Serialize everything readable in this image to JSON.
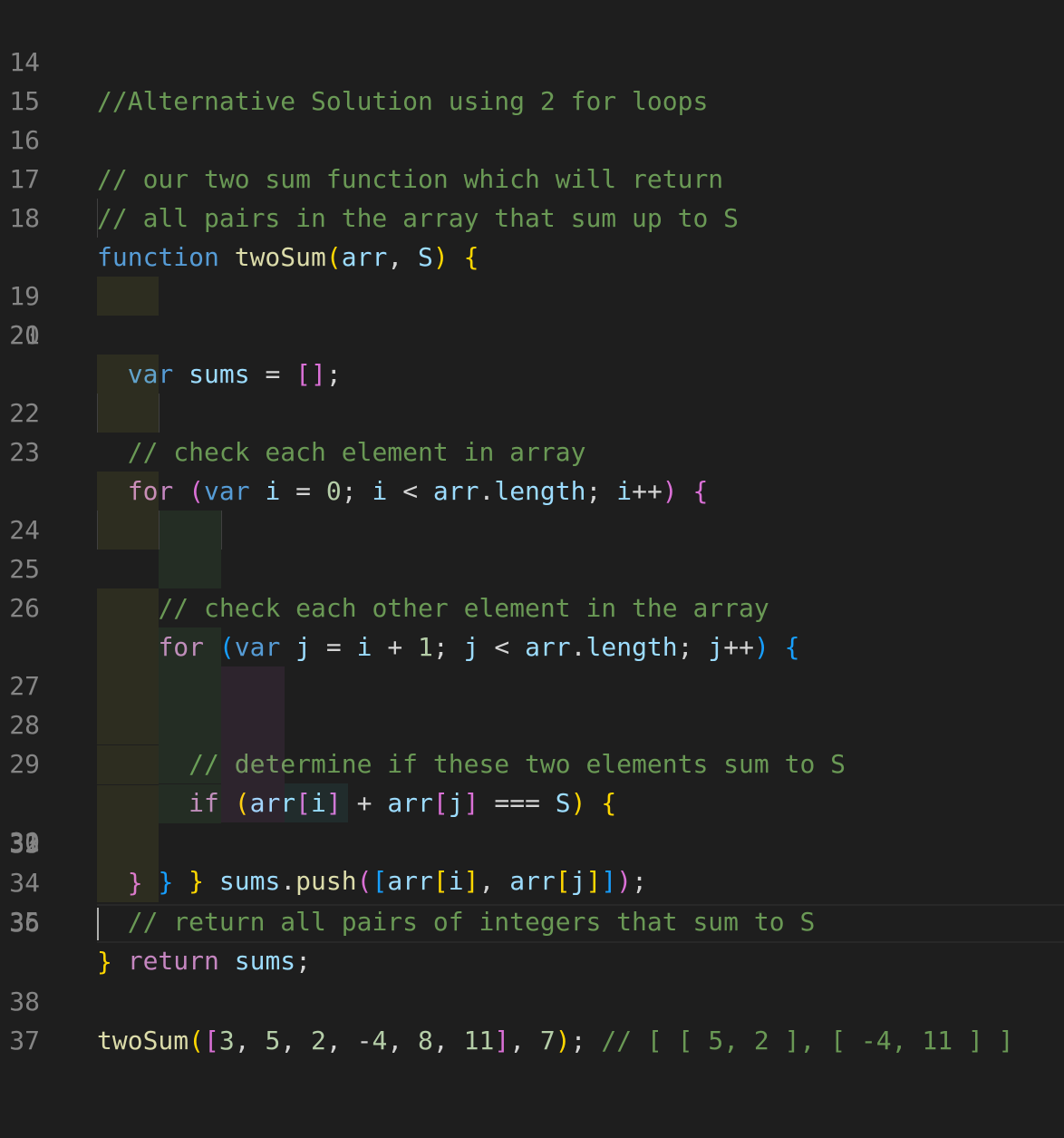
{
  "editor": {
    "lines": [
      {
        "n": "14",
        "text": "//Alternative Solution using 2 for loops"
      },
      {
        "n": "15",
        "text": ""
      },
      {
        "n": "16",
        "text": "// our two sum function which will return"
      },
      {
        "n": "17",
        "text": "// all pairs in the array that sum up to S"
      },
      {
        "n": "18",
        "text": "function twoSum(arr, S) {"
      },
      {
        "n": "19",
        "text": ""
      },
      {
        "n": "20",
        "text": "  var sums = [];"
      },
      {
        "n": "21",
        "text": ""
      },
      {
        "n": "22",
        "text": "  // check each element in array"
      },
      {
        "n": "23",
        "text": "  for (var i = 0; i < arr.length; i++) {"
      },
      {
        "n": "24",
        "text": ""
      },
      {
        "n": "25",
        "text": "    // check each other element in the array"
      },
      {
        "n": "26",
        "text": "    for (var j = i + 1; j < arr.length; j++) {"
      },
      {
        "n": "27",
        "text": ""
      },
      {
        "n": "28",
        "text": "      // determine if these two elements sum to S"
      },
      {
        "n": "29",
        "text": "      if (arr[i] + arr[j] === S) {"
      },
      {
        "n": "30",
        "text": "        sums.push([arr[i], arr[j]]);"
      },
      {
        "n": "31",
        "text": "      }"
      },
      {
        "n": "32",
        "text": "    }"
      },
      {
        "n": "33",
        "text": "  }"
      },
      {
        "n": "34",
        "text": "  // return all pairs of integers that sum to S"
      },
      {
        "n": "35",
        "text": "  return sums;"
      },
      {
        "n": "36",
        "text": "}"
      },
      {
        "n": "37",
        "text": ""
      },
      {
        "n": "38",
        "text": "twoSum([3, 5, 2, -4, 8, 11], 7); // [ [ 5, 2 ], [ -4, 11 ] ]"
      }
    ]
  },
  "colors": {
    "background": "#1e1e1e",
    "line_number": "#858585",
    "comment": "#6a9955",
    "keyword": "#569cd6",
    "control": "#c586c0",
    "function": "#dcdcaa",
    "number": "#b5cea8",
    "bracket_1": "#ffd700",
    "bracket_2": "#da70d6",
    "bracket_3": "#179fff"
  }
}
